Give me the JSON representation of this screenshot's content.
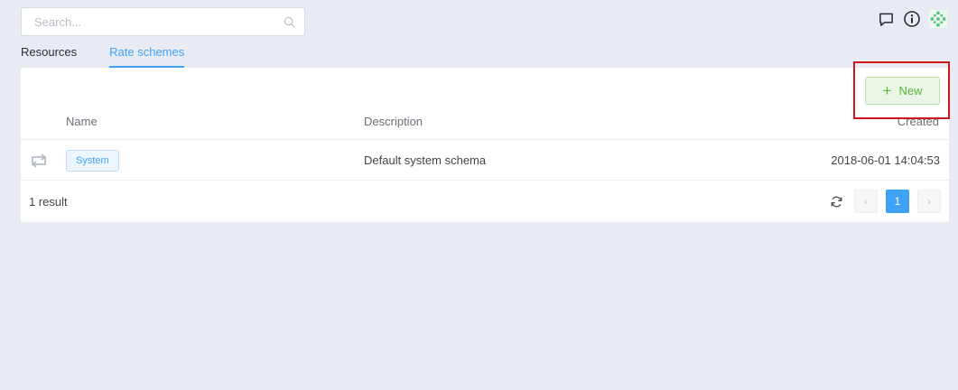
{
  "search": {
    "placeholder": "Search...",
    "value": ""
  },
  "tabs": [
    {
      "label": "Resources",
      "active": false
    },
    {
      "label": "Rate schemes",
      "active": true
    }
  ],
  "toolbar": {
    "new_label": "New"
  },
  "table": {
    "headers": {
      "name": "Name",
      "description": "Description",
      "created": "Created"
    },
    "rows": [
      {
        "name": "System",
        "description": "Default system schema",
        "created": "2018-06-01 14:04:53"
      }
    ]
  },
  "footer": {
    "result_count": "1 result"
  },
  "pagination": {
    "current_page": "1",
    "prev": "‹",
    "next": "›"
  },
  "colors": {
    "accent": "#3fa3f5",
    "success": "#5cb33a",
    "highlight": "#d0161a",
    "background": "#e9ebf4"
  },
  "icons": [
    "search-icon",
    "chat-icon",
    "info-icon",
    "avatar",
    "repeat-icon",
    "refresh-icon",
    "chevron-left-icon",
    "chevron-right-icon",
    "plus-icon"
  ]
}
